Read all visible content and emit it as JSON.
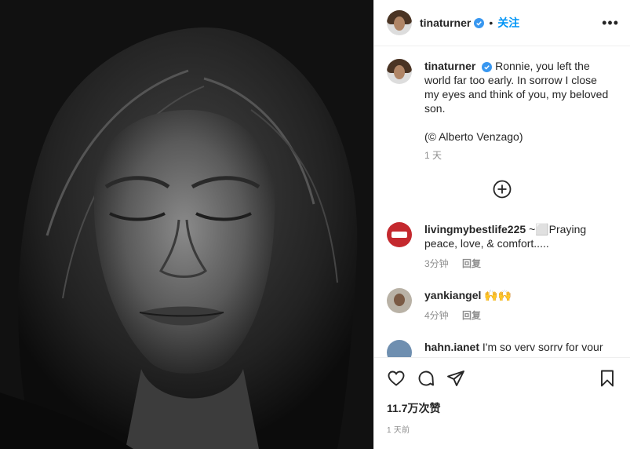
{
  "post": {
    "username": "tinaturner",
    "dot": "•",
    "follow_label": "关注",
    "more_label": "•••"
  },
  "caption": {
    "username": "tinaturner",
    "text": "Ronnie, you left the world far too early. In sorrow I close my eyes and think of you, my beloved son.",
    "credit": "(© Alberto Venzago)",
    "time": "1 天"
  },
  "comments": [
    {
      "username": "livingmybestlife225",
      "text": "~⬜Praying peace, love, & comfort.....",
      "time": "3分钟",
      "reply": "回复"
    },
    {
      "username": "yankiangel",
      "text": "🙌🙌",
      "time": "4分钟",
      "reply": "回复"
    },
    {
      "username": "hahn.ianet",
      "text": "I'm so verv sorrv for vour"
    }
  ],
  "footer": {
    "likes": "11.7万次赞",
    "ago": "1 天前"
  },
  "colors": {
    "accent": "#0095f6",
    "muted": "#8e8e8e",
    "text": "#262626"
  }
}
